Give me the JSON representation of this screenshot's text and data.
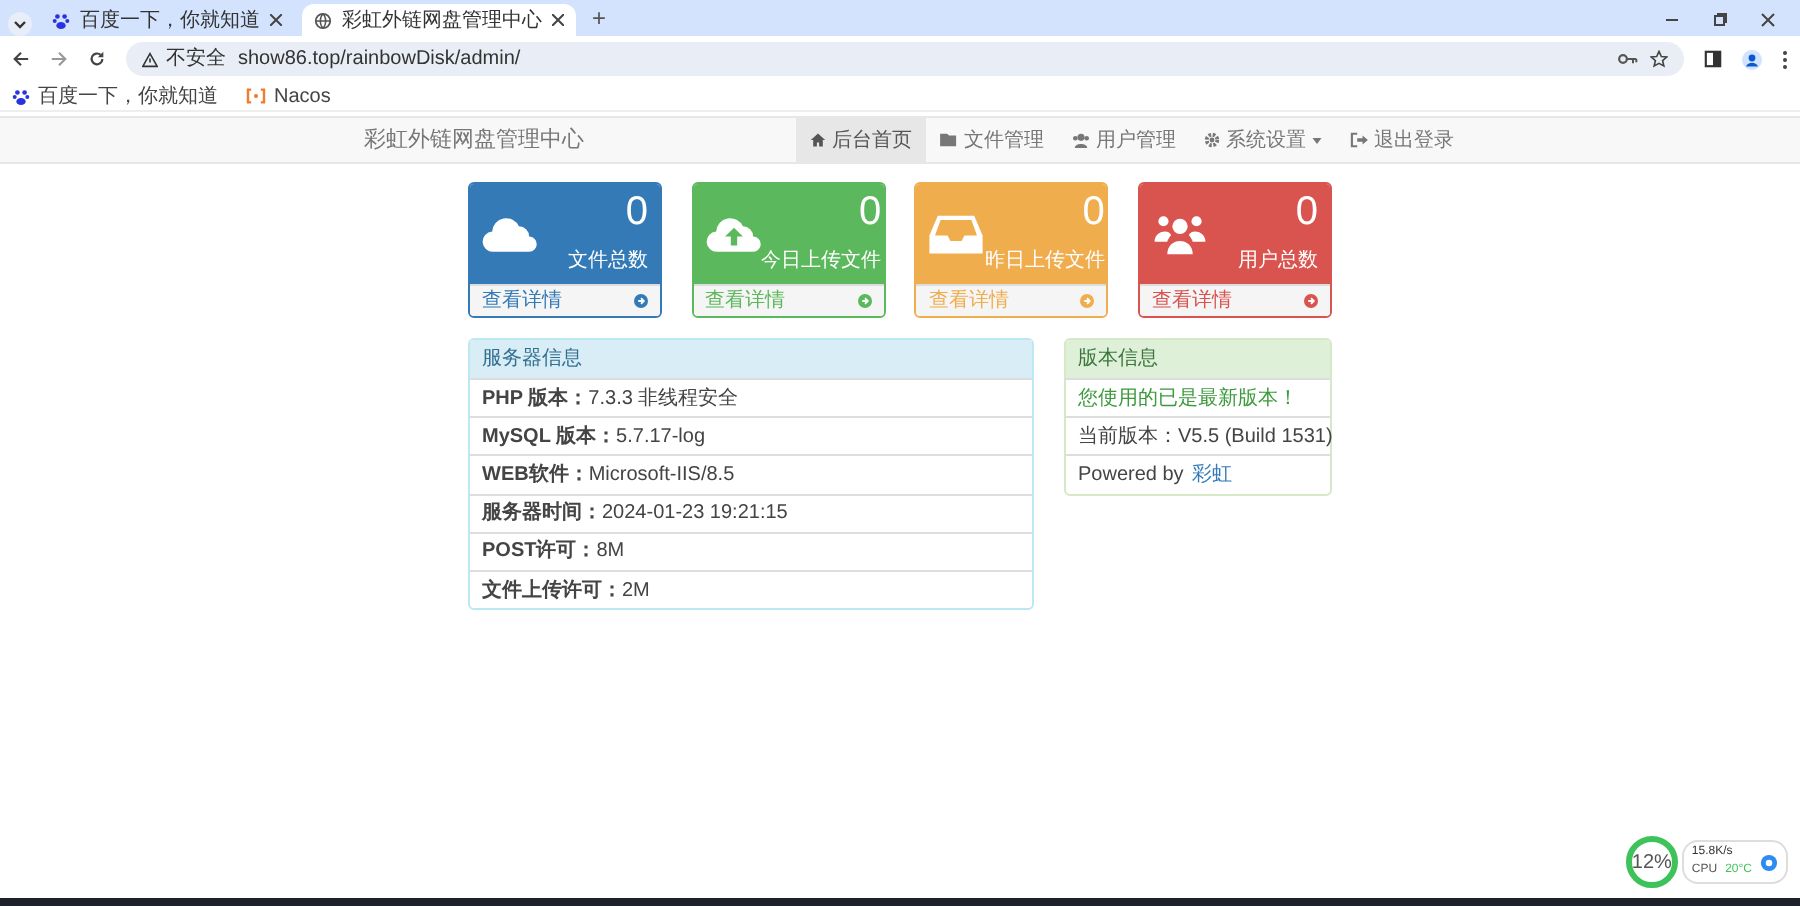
{
  "browser": {
    "tabs": [
      {
        "title": "百度一下，你就知道",
        "selected": false,
        "kind": "baidu"
      },
      {
        "title": "彩虹外链网盘管理中心",
        "selected": true,
        "kind": "globe"
      }
    ],
    "new_tab": "+",
    "security_label": "不安全",
    "address": "show86.top/rainbowDisk/admin/",
    "bookmarks": [
      {
        "title": "百度一下，你就知道",
        "kind": "baidu"
      },
      {
        "title": "Nacos",
        "kind": "nacos"
      }
    ]
  },
  "navbar": {
    "brand": "彩虹外链网盘管理中心",
    "items": [
      {
        "label": "后台首页",
        "kind": "home",
        "selected": true,
        "dropdown": false
      },
      {
        "label": "文件管理",
        "kind": "folder",
        "selected": false,
        "dropdown": false
      },
      {
        "label": "用户管理",
        "kind": "users",
        "selected": false,
        "dropdown": false
      },
      {
        "label": "系统设置",
        "kind": "gear",
        "selected": false,
        "dropdown": true
      },
      {
        "label": "退出登录",
        "kind": "logout",
        "selected": false,
        "dropdown": false
      }
    ]
  },
  "stats": [
    {
      "kind": "cloud",
      "value": "0",
      "label": "文件总数",
      "link": "查看详情",
      "color": "#337ab7"
    },
    {
      "kind": "upload",
      "value": "0",
      "label": "今日上传文件",
      "link": "查看详情",
      "color": "#5cb85c"
    },
    {
      "kind": "inbox",
      "value": "0",
      "label": "昨日上传文件",
      "link": "查看详情",
      "color": "#f0ad4e"
    },
    {
      "kind": "users",
      "value": "0",
      "label": "用户总数",
      "link": "查看详情",
      "color": "#d9534f"
    }
  ],
  "server_panel": {
    "title": "服务器信息",
    "kind": "info",
    "rows": [
      "**PHP 版本：**7.3.3 非线程安全",
      "**MySQL 版本：**5.7.17-log",
      "**WEB软件：**Microsoft-IIS/8.5",
      "**服务器时间：**2024-01-23 19:21:15",
      "**POST许可：**8M",
      "**文件上传许可：**2M"
    ]
  },
  "version_panel": {
    "title": "版本信息",
    "kind": "success",
    "notice": "您使用的已是最新版本！",
    "current": "当前版本：V5.5 (Build 1531)",
    "powered_by": "Powered by",
    "author": "彩虹"
  },
  "monitor": {
    "percent": "12%",
    "speed": "15.8K/s",
    "cpu_label": "CPU",
    "cpu_temp": "20°C"
  }
}
